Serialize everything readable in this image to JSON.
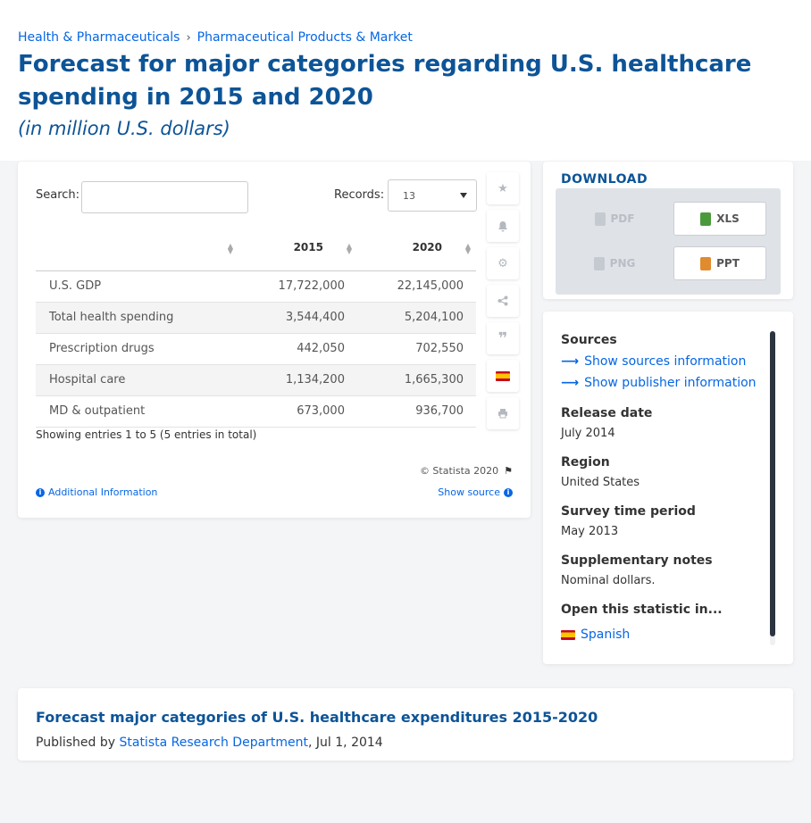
{
  "breadcrumb": {
    "items": [
      "Health & Pharmaceuticals",
      "Pharmaceutical Products & Market"
    ],
    "separator": "›"
  },
  "page": {
    "title": "Forecast for major categories regarding U.S. healthcare spending in 2015 and 2020",
    "subtitle": "(in million U.S. dollars)"
  },
  "table_controls": {
    "search_label": "Search:",
    "search_value": "",
    "records_label": "Records:",
    "records_value": "13"
  },
  "table": {
    "columns": [
      "",
      "2015",
      "2020"
    ],
    "rows": [
      {
        "name": "U.S. GDP",
        "v2015": "17,722,000",
        "v2020": "22,145,000"
      },
      {
        "name": "Total health spending",
        "v2015": "3,544,400",
        "v2020": "5,204,100"
      },
      {
        "name": "Prescription drugs",
        "v2015": "442,050",
        "v2020": "702,550"
      },
      {
        "name": "Hospital care",
        "v2015": "1,134,200",
        "v2020": "1,665,300"
      },
      {
        "name": "MD & outpatient",
        "v2015": "673,000",
        "v2020": "936,700"
      }
    ],
    "entries_info": "Showing entries 1 to 5 (5 entries in total)",
    "copyright": "© Statista 2020",
    "additional_info": "Additional Information",
    "show_source": "Show source"
  },
  "tools": [
    "star-icon",
    "bell-icon",
    "gear-icon",
    "share-icon",
    "quote-icon",
    "spanish-flag-icon",
    "print-icon"
  ],
  "download": {
    "title": "DOWNLOAD",
    "buttons": [
      {
        "label": "PDF",
        "enabled": false
      },
      {
        "label": "XLS",
        "enabled": true
      },
      {
        "label": "PNG",
        "enabled": false
      },
      {
        "label": "PPT",
        "enabled": true
      }
    ]
  },
  "info": {
    "sources_label": "Sources",
    "show_sources": "Show sources information",
    "show_publisher": "Show publisher information",
    "release_label": "Release date",
    "release_value": "July 2014",
    "region_label": "Region",
    "region_value": "United States",
    "survey_label": "Survey time period",
    "survey_value": "May 2013",
    "notes_label": "Supplementary notes",
    "notes_value": "Nominal dollars.",
    "open_label": "Open this statistic in...",
    "open_language": "Spanish"
  },
  "publication": {
    "title": "Forecast major categories of U.S. healthcare expenditures 2015-2020",
    "published_by": "Published by",
    "publisher": "Statista Research Department",
    "date": ", Jul 1, 2014"
  },
  "colors": {
    "title_blue": "#0d5497",
    "link_blue": "#0666e5",
    "background": "#f4f5f7"
  }
}
